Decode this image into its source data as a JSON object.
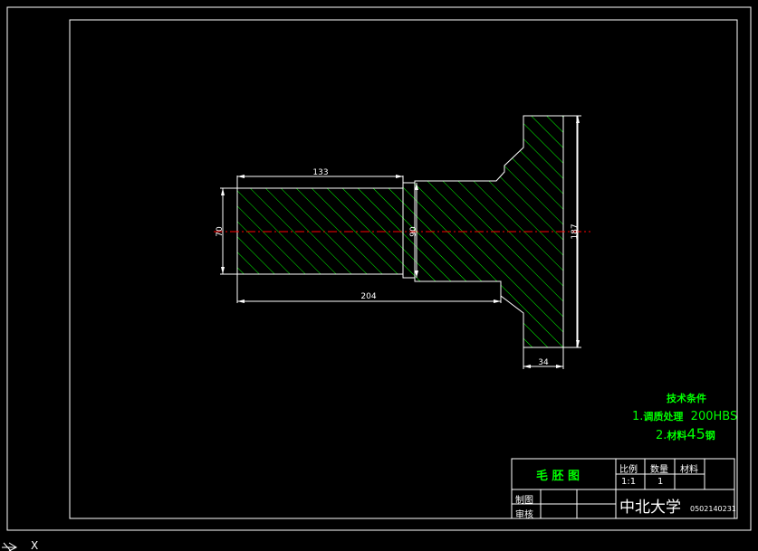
{
  "drawing": {
    "dimensions": {
      "left_length": "133",
      "overall_length": "204",
      "left_diameter": "70",
      "middle_diameter": "90",
      "flange_diameter": "187",
      "flange_thickness": "34"
    },
    "colors": {
      "background": "#000000",
      "outline": "#ffffff",
      "hatch": "#00ff00",
      "centerline": "#ff0000"
    }
  },
  "tech_requirements": {
    "title": "技术条件",
    "line1_prefix": "1.",
    "line1_text": "调质处理",
    "line1_value": "200HBS",
    "line2_prefix": "2.",
    "line2_text": "材料",
    "line2_value": "45",
    "line2_suffix": "钢"
  },
  "title_block": {
    "drawing_name": "毛 胚 图",
    "scale_label": "比例",
    "quantity_label": "数量",
    "material_label": "材料",
    "scale_value": "1:1",
    "quantity_value": "1",
    "drawn_label": "制图",
    "checked_label": "审核",
    "school": "中北大学",
    "code": "0502140231"
  },
  "ucs": {
    "x_label": "X"
  }
}
